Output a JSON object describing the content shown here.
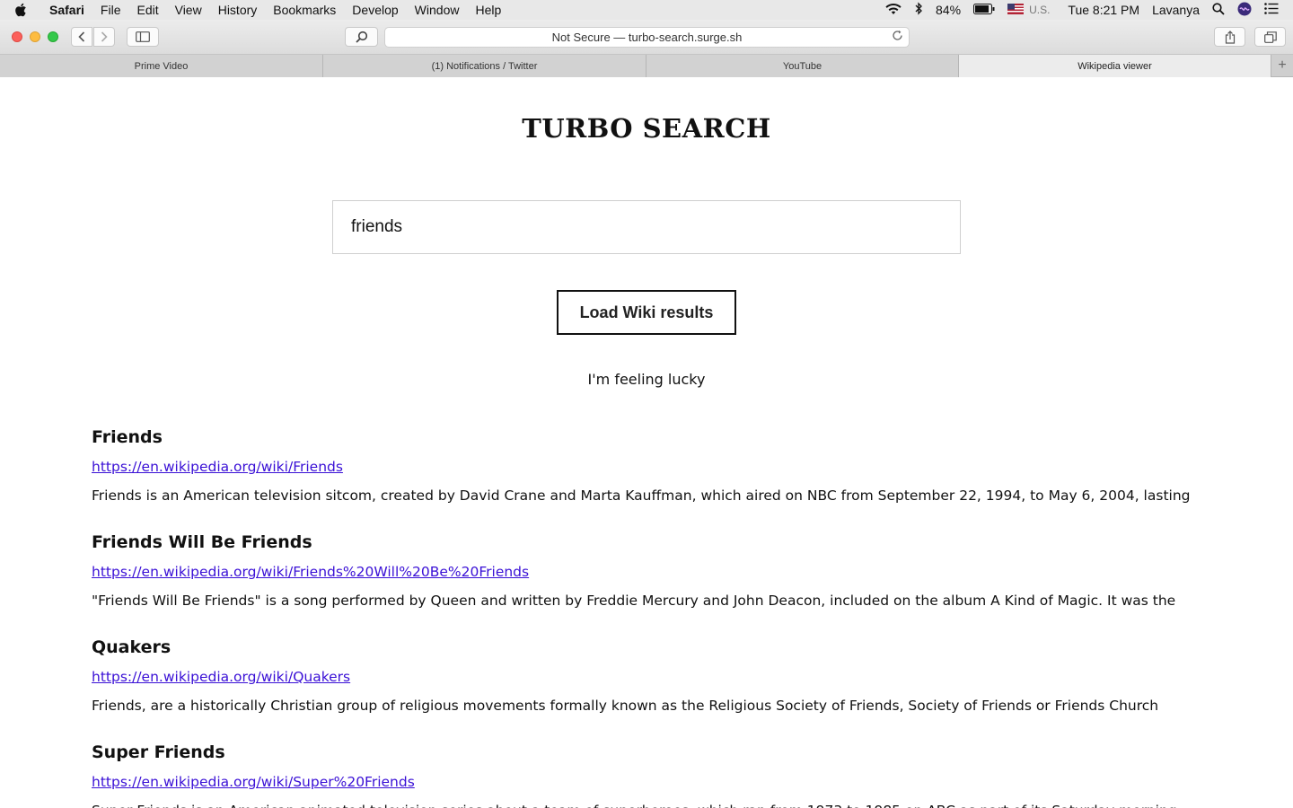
{
  "menubar": {
    "app": "Safari",
    "items": [
      "File",
      "Edit",
      "View",
      "History",
      "Bookmarks",
      "Develop",
      "Window",
      "Help"
    ],
    "battery": "84%",
    "input_source": "U.S.",
    "clock": "Tue 8:21 PM",
    "user": "Lavanya"
  },
  "toolbar": {
    "address": "Not Secure — turbo-search.surge.sh"
  },
  "tabs": [
    {
      "label": "Prime Video"
    },
    {
      "label": "(1) Notifications / Twitter"
    },
    {
      "label": "YouTube"
    },
    {
      "label": "Wikipedia viewer"
    }
  ],
  "page": {
    "title": "TURBO SEARCH",
    "search_value": "friends",
    "load_button": "Load Wiki results",
    "lucky": "I'm feeling lucky",
    "results": [
      {
        "title": "Friends",
        "url": "https://en.wikipedia.org/wiki/Friends",
        "snippet": "Friends is an American television sitcom, created by David Crane and Marta Kauffman, which aired on NBC from September 22, 1994, to May 6, 2004, lasting"
      },
      {
        "title": "Friends Will Be Friends",
        "url": "https://en.wikipedia.org/wiki/Friends%20Will%20Be%20Friends",
        "snippet": "\"Friends Will Be Friends\" is a song performed by Queen and written by Freddie Mercury and John Deacon, included on the album A Kind of Magic. It was the"
      },
      {
        "title": "Quakers",
        "url": "https://en.wikipedia.org/wiki/Quakers",
        "snippet": "Friends, are a historically Christian group of religious movements formally known as the Religious Society of Friends, Society of Friends or Friends Church"
      },
      {
        "title": "Super Friends",
        "url": "https://en.wikipedia.org/wiki/Super%20Friends",
        "snippet": "Super Friends is an American animated television series about a team of superheroes, which ran from 1973 to 1985 on ABC as part of its Saturday morning"
      }
    ]
  }
}
